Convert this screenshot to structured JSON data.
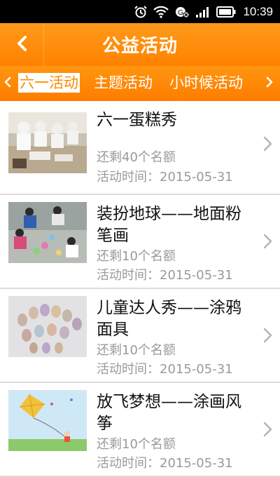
{
  "status_bar": {
    "time": "10:39"
  },
  "header": {
    "title": "公益活动"
  },
  "tabs": [
    {
      "label": "六一活动",
      "active": true
    },
    {
      "label": "主题活动",
      "active": false
    },
    {
      "label": "小时候活动",
      "active": false
    }
  ],
  "activities": [
    {
      "title": "六一蛋糕秀",
      "quota": "还剩40个名额",
      "date": "活动时间：2015-05-31"
    },
    {
      "title": "装扮地球——地面粉笔画",
      "quota": "还剩10个名额",
      "date": "活动时间：2015-05-31"
    },
    {
      "title": "儿童达人秀——涂鸦面具",
      "quota": "还剩10个名额",
      "date": "活动时间：2015-05-31"
    },
    {
      "title": "放飞梦想——涂画风筝",
      "quota": "还剩10个名额",
      "date": "活动时间：2015-05-31"
    }
  ],
  "colors": {
    "accent": "#ff8800",
    "status_bar": "#000000",
    "secondary_text": "#9a9a9a"
  },
  "icons": [
    "alarm-icon",
    "wifi-icon",
    "data-icon",
    "signal-icon",
    "battery-icon",
    "back-arrow-icon",
    "chevron-left-icon",
    "chevron-right-icon"
  ]
}
